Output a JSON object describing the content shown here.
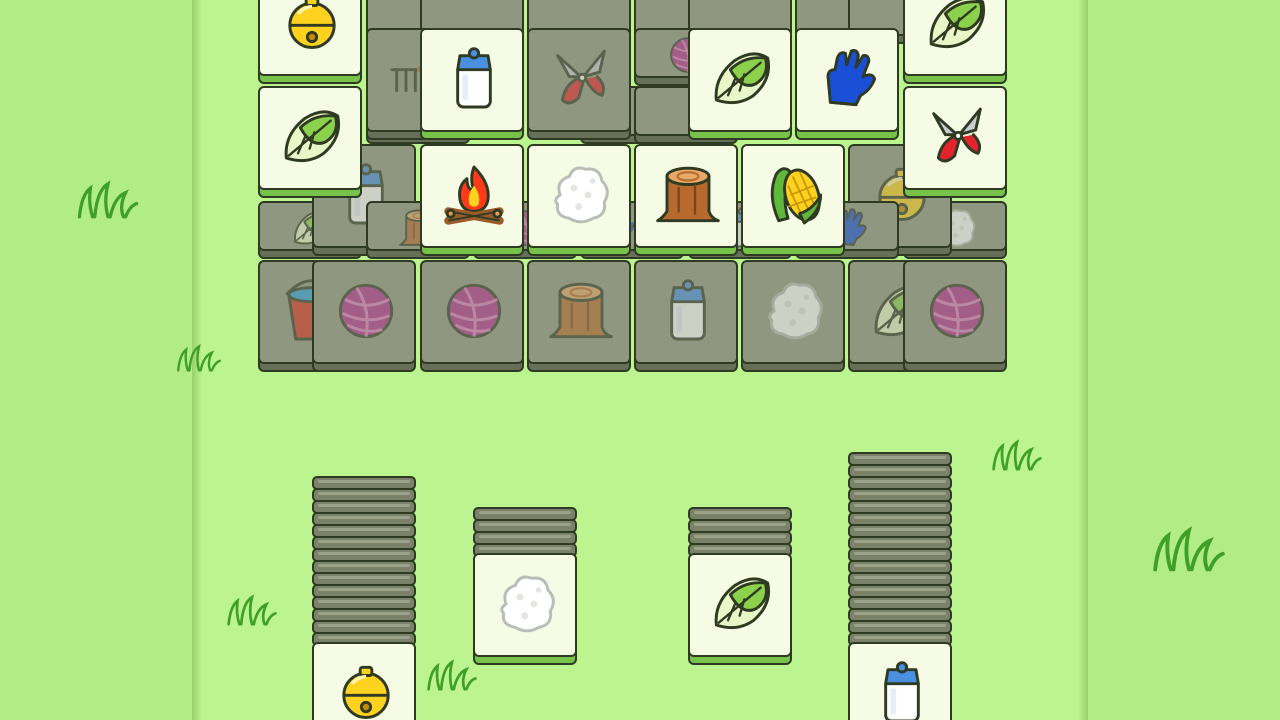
{
  "game": {
    "colors": {
      "background": "#b6ee88",
      "tile_face": "#f5fbe4",
      "tile_side": "#76c24a",
      "blocked_tile_face": "#8f9780",
      "outline": "#2f3a22"
    },
    "board_tiles": [
      {
        "icon": "bell-icon",
        "state": "free"
      },
      {
        "icon": "milk-bottle-icon",
        "state": "free"
      },
      {
        "icon": "cabbage-icon",
        "state": "free"
      },
      {
        "icon": "glove-icon",
        "state": "free"
      },
      {
        "icon": "cabbage-icon",
        "state": "free"
      },
      {
        "icon": "cabbage-icon",
        "state": "free"
      },
      {
        "icon": "shears-icon",
        "state": "free"
      },
      {
        "icon": "campfire-icon",
        "state": "free"
      },
      {
        "icon": "cotton-ball-icon",
        "state": "free"
      },
      {
        "icon": "tree-stump-icon",
        "state": "free"
      },
      {
        "icon": "corn-icon",
        "state": "free"
      },
      {
        "icon": "rake-icon",
        "state": "blocked"
      },
      {
        "icon": "shears-icon",
        "state": "blocked"
      },
      {
        "icon": "yarn-ball-icon",
        "state": "blocked"
      },
      {
        "icon": "milk-bottle-icon",
        "state": "blocked"
      },
      {
        "icon": "bell-icon",
        "state": "blocked"
      },
      {
        "icon": "cabbage-icon",
        "state": "blocked"
      },
      {
        "icon": "cotton-ball-icon",
        "state": "blocked"
      },
      {
        "icon": "tree-stump-icon",
        "state": "blocked"
      },
      {
        "icon": "yarn-ball-icon",
        "state": "blocked"
      },
      {
        "icon": "shovel-icon",
        "state": "blocked"
      },
      {
        "icon": "milk-bottle-icon",
        "state": "blocked"
      },
      {
        "icon": "glove-icon",
        "state": "blocked"
      },
      {
        "icon": "bucket-icon",
        "state": "blocked"
      },
      {
        "icon": "yarn-ball-icon",
        "state": "blocked"
      },
      {
        "icon": "yarn-ball-icon",
        "state": "blocked"
      },
      {
        "icon": "tree-stump-icon",
        "state": "blocked"
      },
      {
        "icon": "milk-bottle-icon",
        "state": "blocked"
      },
      {
        "icon": "cotton-ball-icon",
        "state": "blocked"
      },
      {
        "icon": "cabbage-icon",
        "state": "blocked"
      },
      {
        "icon": "yarn-ball-icon",
        "state": "blocked"
      }
    ],
    "stacks": [
      {
        "top_icon": "bell-icon",
        "layers_below": 14
      },
      {
        "top_icon": "cotton-ball-icon",
        "layers_below": 4
      },
      {
        "top_icon": "cabbage-icon",
        "layers_below": 4
      },
      {
        "top_icon": "milk-bottle-icon",
        "layers_below": 16
      }
    ]
  }
}
